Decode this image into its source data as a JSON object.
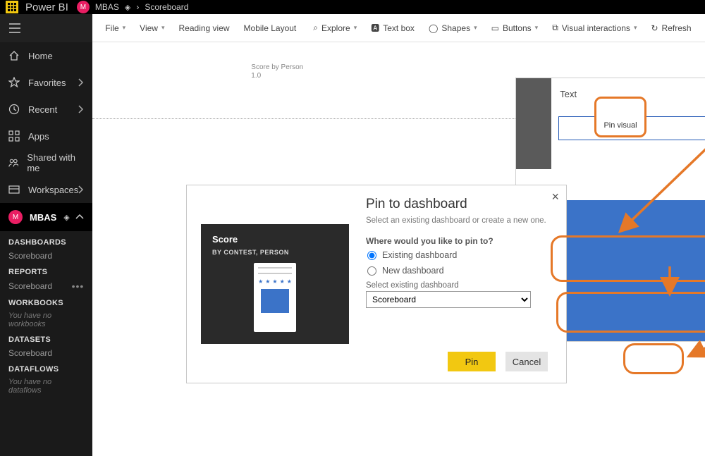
{
  "header": {
    "app_name": "Power BI",
    "workspace_badge": "M",
    "workspace_name": "MBAS",
    "breadcrumb_item": "Scoreboard"
  },
  "sidebar": {
    "home": "Home",
    "favorites": "Favorites",
    "recent": "Recent",
    "apps": "Apps",
    "shared": "Shared with me",
    "workspaces": "Workspaces",
    "ws_badge": "M",
    "ws_name": "MBAS",
    "sections": {
      "dashboards": {
        "header": "DASHBOARDS",
        "item": "Scoreboard"
      },
      "reports": {
        "header": "REPORTS",
        "item": "Scoreboard"
      },
      "workbooks": {
        "header": "WORKBOOKS",
        "hint": "You have no workbooks"
      },
      "datasets": {
        "header": "DATASETS",
        "item": "Scoreboard"
      },
      "dataflows": {
        "header": "DATAFLOWS",
        "hint": "You have no dataflows"
      }
    }
  },
  "toolbar": {
    "file": "File",
    "view": "View",
    "reading_view": "Reading view",
    "mobile_layout": "Mobile Layout",
    "explore": "Explore",
    "text_box": "Text box",
    "shapes": "Shapes",
    "buttons": "Buttons",
    "visual_interactions": "Visual interactions",
    "refresh": "Refresh"
  },
  "canvas": {
    "chart_title": "Score by Person",
    "chart_sub": "1.0",
    "text_visual_label": "Text"
  },
  "pin_tooltip": "Pin visual",
  "modal": {
    "title": "Pin to dashboard",
    "description": "Select an existing dashboard or create a new one.",
    "question": "Where would you like to pin to?",
    "opt_existing": "Existing dashboard",
    "opt_new": "New dashboard",
    "select_label": "Select existing dashboard",
    "select_value": "Scoreboard",
    "preview_title": "Score",
    "preview_sub": "BY CONTEST, PERSON",
    "pin": "Pin",
    "cancel": "Cancel"
  }
}
